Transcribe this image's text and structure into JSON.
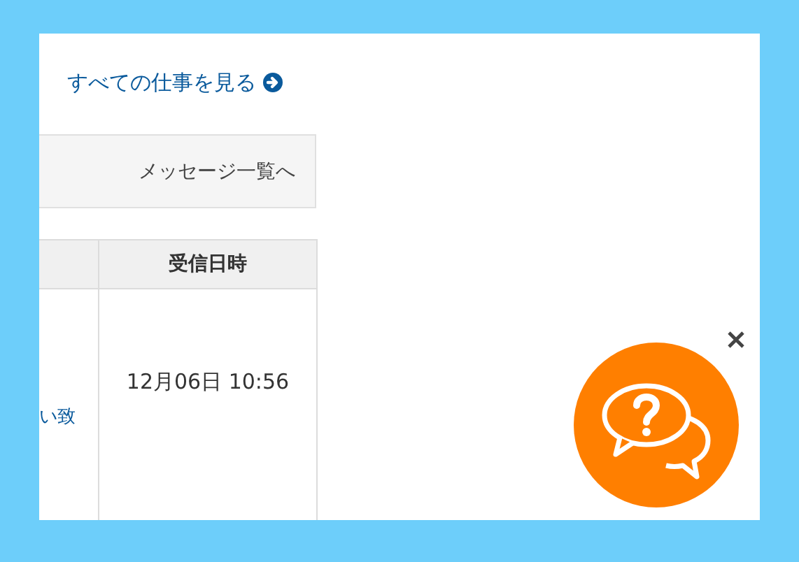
{
  "all_jobs_link": "すべての仕事を見る",
  "messages_button": "メッセージ一覧へ",
  "table": {
    "columns": [
      "受信日時"
    ],
    "rows": [
      {
        "column_1": "い致",
        "received": "12月06日 10:56"
      }
    ]
  }
}
